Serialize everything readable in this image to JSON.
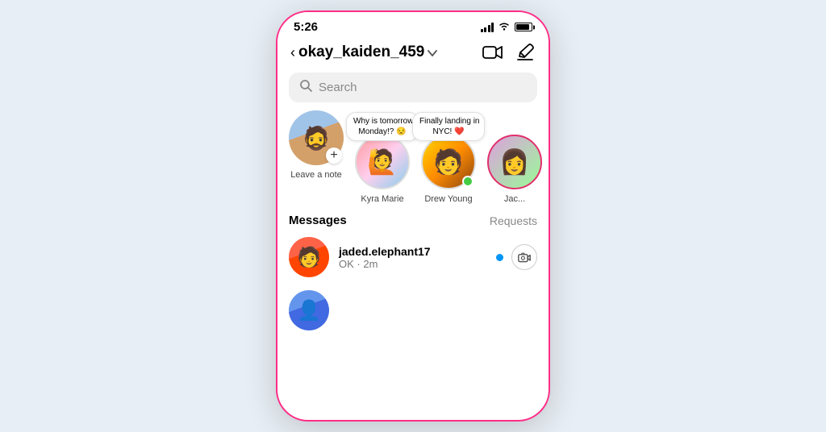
{
  "statusBar": {
    "time": "5:26"
  },
  "header": {
    "back": "‹",
    "username": "okay_kaiden_459",
    "chevron": "∨",
    "videoIcon": "video-icon",
    "editIcon": "edit-icon"
  },
  "search": {
    "placeholder": "Search"
  },
  "stories": [
    {
      "id": "leave-note",
      "name": "Leave a note",
      "hasPlus": true,
      "isNote": true,
      "note": null,
      "emoji": "🧔"
    },
    {
      "id": "kyra-marie",
      "name": "Kyra Marie",
      "hasNote": true,
      "noteText": "Why is tomorrow Monday!? 😒",
      "isOnline": false,
      "emoji": "🙋"
    },
    {
      "id": "drew-young",
      "name": "Drew Young",
      "hasNote": true,
      "noteText": "Finally landing in NYC! ❤️",
      "isOnline": true,
      "emoji": "👦"
    },
    {
      "id": "jac",
      "name": "Jac...",
      "partial": true,
      "emoji": "👩"
    }
  ],
  "tabs": {
    "messages": "Messages",
    "requests": "Requests"
  },
  "messages": [
    {
      "id": "jaded-elephant17",
      "username": "jaded.elephant17",
      "preview": "OK · 2m",
      "hasUnread": true,
      "hasCamera": true,
      "emoji": "🧑"
    },
    {
      "id": "msg2",
      "username": "",
      "preview": "",
      "hasUnread": false,
      "hasCamera": false,
      "emoji": "👤"
    }
  ]
}
